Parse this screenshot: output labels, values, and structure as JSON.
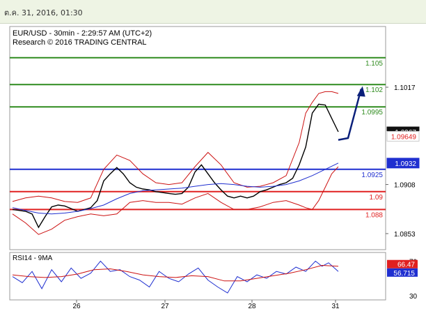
{
  "header": {
    "date_text": "ต.ค. 31, 2016, 01:30"
  },
  "chart_data": [
    {
      "type": "line",
      "title": "EUR/USD - 30min - 2:29:57 AM (UTC+2)",
      "subtitle": "Research © 2016 TRADING CENTRAL",
      "ylim": [
        1.0835,
        1.1085
      ],
      "y_ticks": [
        {
          "label": "1.1017",
          "value": 1.1017
        },
        {
          "label": "1.0908",
          "value": 1.0908
        },
        {
          "label": "1.0853",
          "value": 1.0853
        }
      ],
      "x_ticks": [
        "26",
        "27",
        "28",
        "31"
      ],
      "levels": [
        {
          "label": "1.105",
          "value": 1.105,
          "color": "#2e8b1e"
        },
        {
          "label": "1.102",
          "value": 1.102,
          "color": "#2e8b1e"
        },
        {
          "label": "1.0995",
          "value": 1.0995,
          "color": "#2e8b1e"
        },
        {
          "label": "1.0925",
          "value": 1.0925,
          "color": "#1f2fd0"
        },
        {
          "label": "1.09",
          "value": 1.09,
          "color": "#e02020"
        },
        {
          "label": "1.088",
          "value": 1.088,
          "color": "#e02020"
        }
      ],
      "price_tags": [
        {
          "label": "1.0967",
          "value": 1.0967,
          "bg": "#111111",
          "fg": "#ffffff"
        },
        {
          "label": "1.09649",
          "value": 1.0962,
          "bg": "#ffffff",
          "fg": "#e02020"
        },
        {
          "label": "1.0932",
          "value": 1.0932,
          "bg": "#1f2fd0",
          "fg": "#ffffff"
        }
      ],
      "series": [
        {
          "name": "price",
          "color": "#000000",
          "x": [
            0,
            2,
            4,
            6,
            8,
            10,
            12,
            14,
            16,
            18,
            20,
            22,
            24,
            26,
            28,
            30,
            32,
            34,
            36,
            38,
            40,
            42,
            44,
            46,
            48,
            50,
            52,
            54,
            56,
            58,
            60,
            62,
            64,
            66,
            68,
            70,
            72,
            74,
            76,
            78,
            80,
            82,
            84,
            86,
            88,
            90,
            92,
            94,
            96,
            98,
            100
          ],
          "values": [
            1.088,
            1.0879,
            1.0878,
            1.0875,
            1.086,
            1.0872,
            1.0883,
            1.0885,
            1.0884,
            1.0881,
            1.0878,
            1.088,
            1.0882,
            1.089,
            1.0912,
            1.092,
            1.0927,
            1.092,
            1.091,
            1.0905,
            1.0903,
            1.0902,
            1.09,
            1.0899,
            1.0898,
            1.0897,
            1.0898,
            1.0905,
            1.0922,
            1.093,
            1.092,
            1.091,
            1.0902,
            1.0895,
            1.0893,
            1.0895,
            1.0893,
            1.0895,
            1.09,
            1.0902,
            1.0905,
            1.0908,
            1.091,
            1.0915,
            1.093,
            1.095,
            1.0988,
            1.0998,
            1.0997,
            1.0982,
            1.0967
          ]
        },
        {
          "name": "bollinger-upper",
          "color": "#cc1111",
          "x": [
            0,
            4,
            8,
            12,
            16,
            20,
            24,
            28,
            32,
            36,
            40,
            44,
            48,
            52,
            56,
            60,
            64,
            68,
            72,
            76,
            80,
            84,
            88,
            90,
            92,
            94,
            96,
            98,
            100
          ],
          "values": [
            1.0889,
            1.0893,
            1.0895,
            1.0893,
            1.0889,
            1.0888,
            1.0893,
            1.0925,
            1.0941,
            1.0935,
            1.092,
            1.091,
            1.0908,
            1.091,
            1.0928,
            1.0944,
            1.093,
            1.091,
            1.0905,
            1.0906,
            1.091,
            1.0918,
            1.0955,
            1.0988,
            1.1,
            1.101,
            1.1012,
            1.1012,
            1.101
          ]
        },
        {
          "name": "bollinger-lower",
          "color": "#cc1111",
          "x": [
            0,
            4,
            8,
            12,
            16,
            20,
            24,
            28,
            32,
            36,
            40,
            44,
            48,
            52,
            56,
            60,
            64,
            68,
            72,
            76,
            80,
            84,
            88,
            90,
            92,
            94,
            96,
            98,
            100
          ],
          "values": [
            1.0875,
            1.0865,
            1.0852,
            1.0858,
            1.0868,
            1.0872,
            1.0875,
            1.0873,
            1.0875,
            1.0888,
            1.089,
            1.0888,
            1.0888,
            1.0886,
            1.0893,
            1.0898,
            1.0888,
            1.088,
            1.088,
            1.0883,
            1.0888,
            1.089,
            1.0885,
            1.0882,
            1.088,
            1.089,
            1.0905,
            1.092,
            1.0928
          ]
        },
        {
          "name": "moving-average",
          "color": "#1f2fd0",
          "x": [
            0,
            4,
            8,
            12,
            16,
            20,
            24,
            28,
            32,
            36,
            40,
            44,
            48,
            52,
            56,
            60,
            64,
            68,
            72,
            76,
            80,
            84,
            88,
            92,
            96,
            100
          ],
          "values": [
            1.0882,
            1.0879,
            1.0876,
            1.0875,
            1.0876,
            1.0878,
            1.0881,
            1.0885,
            1.0892,
            1.0898,
            1.0901,
            1.0902,
            1.0903,
            1.0904,
            1.0906,
            1.0908,
            1.0909,
            1.0908,
            1.0906,
            1.0905,
            1.0906,
            1.0908,
            1.0912,
            1.0918,
            1.0925,
            1.0932
          ]
        }
      ],
      "forecast_arrow": {
        "x": [
          100,
          103,
          107
        ],
        "values": [
          1.0958,
          1.096,
          1.1015
        ],
        "color": "#0a1f7a"
      }
    },
    {
      "type": "line",
      "title": "RSI14 - 9MA",
      "ylim": [
        25,
        80
      ],
      "y_ticks": [
        {
          "label": "70",
          "value": 70
        },
        {
          "label": "30",
          "value": 30
        }
      ],
      "value_tags": [
        {
          "label": "66.47",
          "value": 66.47,
          "bg": "#e02020",
          "fg": "#ffffff"
        },
        {
          "label": "56.715",
          "value": 56.715,
          "bg": "#1f2fd0",
          "fg": "#ffffff"
        }
      ],
      "series": [
        {
          "name": "rsi",
          "color": "#1f2fd0",
          "x": [
            0,
            3,
            6,
            9,
            12,
            15,
            18,
            21,
            24,
            27,
            30,
            33,
            36,
            39,
            42,
            45,
            48,
            51,
            54,
            57,
            60,
            63,
            66,
            69,
            72,
            75,
            78,
            81,
            84,
            87,
            90,
            93,
            95,
            97,
            100
          ],
          "values": [
            52,
            45,
            58,
            38,
            60,
            46,
            62,
            50,
            56,
            70,
            58,
            60,
            52,
            48,
            40,
            58,
            50,
            46,
            55,
            62,
            48,
            40,
            33,
            52,
            46,
            54,
            50,
            58,
            55,
            63,
            58,
            70,
            64,
            68,
            58
          ]
        },
        {
          "name": "rsi-ma",
          "color": "#cc1111",
          "x": [
            0,
            5,
            10,
            15,
            20,
            25,
            30,
            35,
            40,
            45,
            50,
            55,
            60,
            65,
            70,
            75,
            80,
            85,
            90,
            95,
            100
          ],
          "values": [
            54,
            52,
            51,
            52,
            55,
            60,
            61,
            58,
            54,
            52,
            51,
            53,
            52,
            47,
            47,
            50,
            53,
            56,
            60,
            65,
            64
          ]
        }
      ]
    }
  ]
}
